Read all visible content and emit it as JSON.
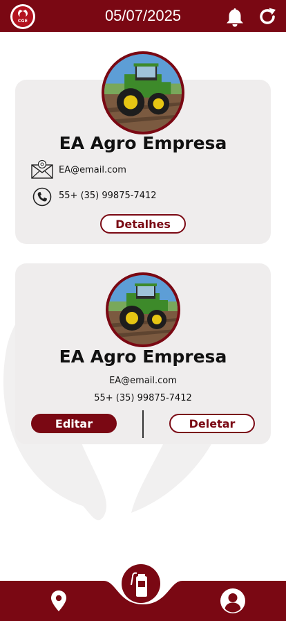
{
  "header": {
    "logo_text": "CGE",
    "date": "05/07/2025",
    "notification_icon": "bell-icon",
    "refresh_icon": "refresh-icon"
  },
  "companies": [
    {
      "name": "EA Agro Empresa",
      "email": "EA@email.com",
      "phone": "55+ (35) 99875-7412",
      "image": "tractor-photo",
      "details_label": "Detalhes"
    },
    {
      "name": "EA Agro Empresa",
      "email": "EA@email.com",
      "phone": "55+ (35) 99875-7412",
      "image": "tractor-photo",
      "edit_label": "Editar",
      "delete_label": "Deletar"
    }
  ],
  "bottom_nav": {
    "items": [
      "location-icon",
      "fire-extinguisher-icon",
      "profile-icon"
    ]
  },
  "colors": {
    "brand": "#7a0813",
    "card_background": "#efeded",
    "watermark": "#f1f0f0"
  }
}
